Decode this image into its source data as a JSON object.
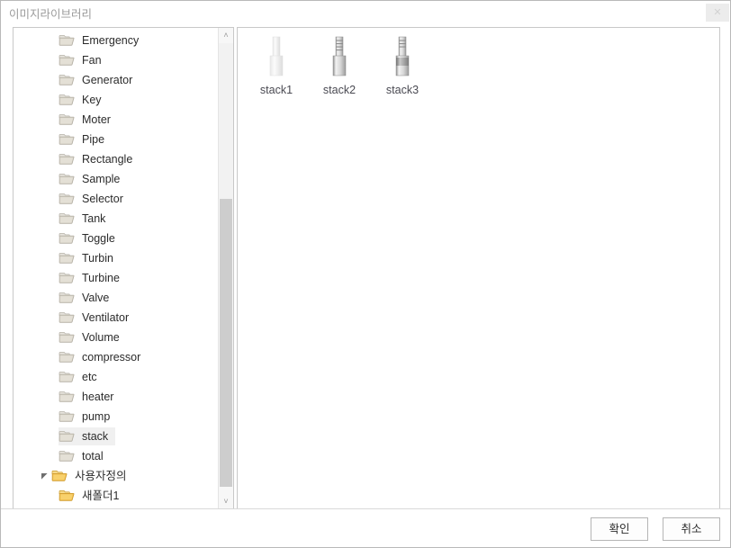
{
  "window": {
    "title": "이미지라이브러리",
    "close_label": "✕"
  },
  "tree": {
    "items": [
      {
        "label": "Emergency",
        "level": 1,
        "selected": false,
        "expandable": false,
        "folder": "closed-grey"
      },
      {
        "label": "Fan",
        "level": 1,
        "selected": false,
        "expandable": false,
        "folder": "closed-grey"
      },
      {
        "label": "Generator",
        "level": 1,
        "selected": false,
        "expandable": false,
        "folder": "closed-grey"
      },
      {
        "label": "Key",
        "level": 1,
        "selected": false,
        "expandable": false,
        "folder": "closed-grey"
      },
      {
        "label": "Moter",
        "level": 1,
        "selected": false,
        "expandable": false,
        "folder": "closed-grey"
      },
      {
        "label": "Pipe",
        "level": 1,
        "selected": false,
        "expandable": false,
        "folder": "closed-grey"
      },
      {
        "label": "Rectangle",
        "level": 1,
        "selected": false,
        "expandable": false,
        "folder": "closed-grey"
      },
      {
        "label": "Sample",
        "level": 1,
        "selected": false,
        "expandable": false,
        "folder": "closed-grey"
      },
      {
        "label": "Selector",
        "level": 1,
        "selected": false,
        "expandable": false,
        "folder": "closed-grey"
      },
      {
        "label": "Tank",
        "level": 1,
        "selected": false,
        "expandable": false,
        "folder": "closed-grey"
      },
      {
        "label": "Toggle",
        "level": 1,
        "selected": false,
        "expandable": false,
        "folder": "closed-grey"
      },
      {
        "label": "Turbin",
        "level": 1,
        "selected": false,
        "expandable": false,
        "folder": "closed-grey"
      },
      {
        "label": "Turbine",
        "level": 1,
        "selected": false,
        "expandable": false,
        "folder": "closed-grey"
      },
      {
        "label": "Valve",
        "level": 1,
        "selected": false,
        "expandable": false,
        "folder": "closed-grey"
      },
      {
        "label": "Ventilator",
        "level": 1,
        "selected": false,
        "expandable": false,
        "folder": "closed-grey"
      },
      {
        "label": "Volume",
        "level": 1,
        "selected": false,
        "expandable": false,
        "folder": "closed-grey"
      },
      {
        "label": "compressor",
        "level": 1,
        "selected": false,
        "expandable": false,
        "folder": "closed-grey"
      },
      {
        "label": "etc",
        "level": 1,
        "selected": false,
        "expandable": false,
        "folder": "closed-grey"
      },
      {
        "label": "heater",
        "level": 1,
        "selected": false,
        "expandable": false,
        "folder": "closed-grey"
      },
      {
        "label": "pump",
        "level": 1,
        "selected": false,
        "expandable": false,
        "folder": "closed-grey"
      },
      {
        "label": "stack",
        "level": 1,
        "selected": true,
        "expandable": false,
        "folder": "closed-grey"
      },
      {
        "label": "total",
        "level": 1,
        "selected": false,
        "expandable": false,
        "folder": "closed-grey"
      },
      {
        "label": "사용자정의",
        "level": 0,
        "selected": false,
        "expandable": true,
        "expanded": true,
        "folder": "open-yellow"
      },
      {
        "label": "새폴더1",
        "level": 1,
        "selected": false,
        "expandable": false,
        "folder": "open-yellow"
      }
    ],
    "scrollbar": {
      "up_arrow": "˄",
      "down_arrow": "˅"
    }
  },
  "thumbnails": [
    {
      "label": "stack1",
      "icon": "smokestack-plain-icon"
    },
    {
      "label": "stack2",
      "icon": "smokestack-ribbed-icon"
    },
    {
      "label": "stack3",
      "icon": "smokestack-banded-icon"
    }
  ],
  "footer": {
    "ok_label": "확인",
    "cancel_label": "취소"
  },
  "colors": {
    "selection": "#f0f0f0",
    "panel_border": "#c8c8c8",
    "title_text": "#9a9a9a",
    "scroll_thumb": "#cdcdcd",
    "folder_grey": "#d8d4cc",
    "folder_yellow": "#f2c14b"
  }
}
